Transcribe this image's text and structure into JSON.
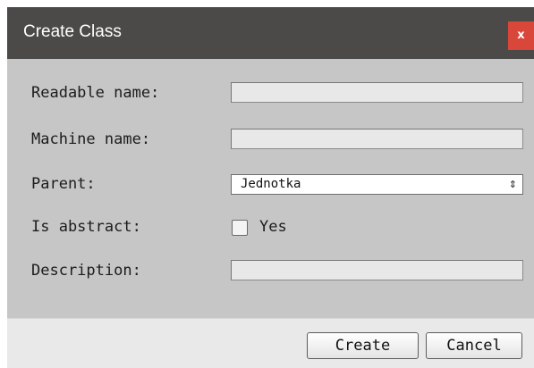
{
  "dialog": {
    "title": "Create Class",
    "close_label": "x"
  },
  "form": {
    "readable_name": {
      "label": "Readable name:",
      "value": ""
    },
    "machine_name": {
      "label": "Machine name:",
      "value": ""
    },
    "parent": {
      "label": "Parent:",
      "selected": "Jednotka",
      "arrow": "⇕"
    },
    "is_abstract": {
      "label": "Is abstract:",
      "checkbox_label": "Yes",
      "checked": false
    },
    "description": {
      "label": "Description:",
      "value": ""
    }
  },
  "footer": {
    "create_label": "Create",
    "cancel_label": "Cancel"
  },
  "colors": {
    "titlebar": "#4b4a49",
    "close_button": "#d9463a",
    "body": "#c6c6c6",
    "footer": "#e9e9e9"
  }
}
